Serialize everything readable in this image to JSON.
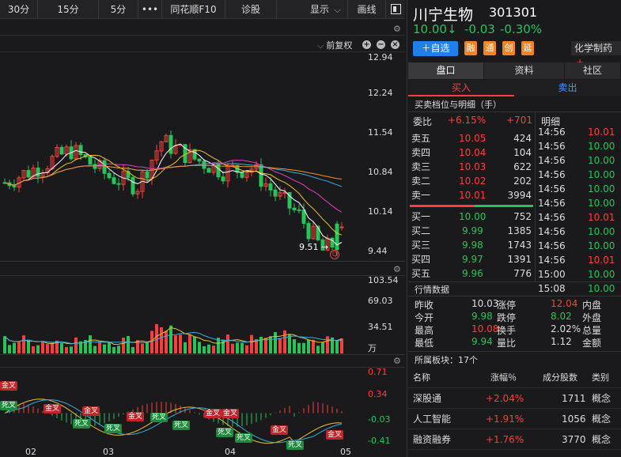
{
  "toolbar": {
    "periods": [
      "30分",
      "15分",
      "5分"
    ],
    "more": "•••",
    "f10": "同花顺F10",
    "diagnose": "诊股",
    "display": "显示",
    "draw": "画线"
  },
  "chart": {
    "adjust": "前复权",
    "price_axis": [
      "12.94",
      "12.24",
      "11.54",
      "10.84",
      "10.14",
      "9.44"
    ],
    "low_marker": "9.51",
    "volume_axis": [
      "103.54",
      "69.03",
      "34.51",
      "万"
    ],
    "macd_axis": [
      "0.71",
      "0.34",
      "-0.03",
      "-0.41"
    ],
    "months": [
      "02",
      "03",
      "04",
      "05"
    ],
    "golden": "金叉",
    "dead": "死叉"
  },
  "chart_data": {
    "type": "candlestick",
    "price_ylim": [
      9.44,
      12.94
    ],
    "price_ticks": [
      12.94,
      12.24,
      11.54,
      10.84,
      10.14,
      9.44
    ],
    "volume_ticks": [
      103.54,
      69.03,
      34.51
    ],
    "volume_unit": "万",
    "macd_ticks": [
      0.71,
      0.34,
      -0.03,
      -0.41
    ],
    "x_months": [
      "02",
      "03",
      "04",
      "05"
    ],
    "annotated_low": 9.51,
    "colors": {
      "up": "#ff3d3d",
      "down": "#27c45a",
      "ma5": "#ffffff",
      "ma10": "#f0c020",
      "ma20": "#e040c0",
      "ma60": "#30b0e0",
      "ma120": "#ff8c20"
    }
  },
  "stock": {
    "name": "川宁生物",
    "code": "301301",
    "price": "10.00↓",
    "change": "-0.03",
    "pct": "-0.30%",
    "add_watch": "＋自选",
    "badges": [
      "融",
      "通",
      "创",
      "延"
    ],
    "industry": "化学制药"
  },
  "tabs": {
    "main": [
      "盘口",
      "资料",
      "社区"
    ],
    "buy": "买入",
    "sell": "卖出",
    "depth_title": "买卖档位与明细（手）"
  },
  "orderbook": {
    "weibi_label": "委比",
    "weibi_pct": "+6.15%",
    "weibi_val": "+701",
    "detail_label": "明细",
    "asks": [
      {
        "label": "卖五",
        "price": "10.05",
        "vol": "424"
      },
      {
        "label": "卖四",
        "price": "10.04",
        "vol": "104"
      },
      {
        "label": "卖三",
        "price": "10.03",
        "vol": "622"
      },
      {
        "label": "卖二",
        "price": "10.02",
        "vol": "202"
      },
      {
        "label": "卖一",
        "price": "10.01",
        "vol": "3994"
      }
    ],
    "bids": [
      {
        "label": "买一",
        "price": "10.00",
        "vol": "752"
      },
      {
        "label": "买二",
        "price": "9.99",
        "vol": "1385"
      },
      {
        "label": "买三",
        "price": "9.98",
        "vol": "1743"
      },
      {
        "label": "买四",
        "price": "9.97",
        "vol": "1391"
      },
      {
        "label": "买五",
        "price": "9.96",
        "vol": "776"
      }
    ]
  },
  "ticks": [
    {
      "time": "14:56",
      "price": "10.01"
    },
    {
      "time": "14:56",
      "price": "10.00"
    },
    {
      "time": "14:56",
      "price": "10.00"
    },
    {
      "time": "14:56",
      "price": "10.00"
    },
    {
      "time": "14:56",
      "price": "10.00"
    },
    {
      "time": "14:56",
      "price": "10.00"
    },
    {
      "time": "14:56",
      "price": "10.01"
    },
    {
      "time": "14:56",
      "price": "10.00"
    },
    {
      "time": "14:56",
      "price": "10.00"
    },
    {
      "time": "14:56",
      "price": "10.01"
    },
    {
      "time": "15:00",
      "price": "10.00"
    },
    {
      "time": "15:08",
      "price": "10.00"
    }
  ],
  "quote": {
    "title": "行情数据",
    "rows": [
      {
        "l1": "昨收",
        "v1": "10.03",
        "l2": "涨停",
        "v2": "12.04",
        "l3": "内盘"
      },
      {
        "l1": "今开",
        "v1": "9.98",
        "l2": "跌停",
        "v2": "8.02",
        "l3": "外盘"
      },
      {
        "l1": "最高",
        "v1": "10.08",
        "l2": "换手",
        "v2": "2.02%",
        "l3": "总量"
      },
      {
        "l1": "最低",
        "v1": "9.94",
        "l2": "量比",
        "v2": "1.12",
        "l3": "金额"
      }
    ]
  },
  "sectors": {
    "title": "所属板块：17个",
    "headers": [
      "名称",
      "涨幅％",
      "成分股数",
      "类别"
    ],
    "rows": [
      {
        "name": "深股通",
        "pct": "+2.04%",
        "count": "1711",
        "type": "概念"
      },
      {
        "name": "人工智能",
        "pct": "+1.91%",
        "count": "1056",
        "type": "概念"
      },
      {
        "name": "融资融券",
        "pct": "+1.76%",
        "count": "3770",
        "type": "概念"
      }
    ]
  }
}
